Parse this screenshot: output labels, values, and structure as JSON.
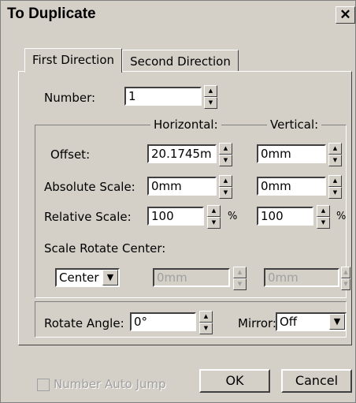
{
  "window": {
    "title": "To Duplicate",
    "close_glyph": "✕"
  },
  "tabs": [
    {
      "label": "First Direction",
      "active": true
    },
    {
      "label": "Second Direction",
      "active": false
    }
  ],
  "number": {
    "label": "Number:",
    "value": "1"
  },
  "columns": {
    "horizontal": "Horizontal:",
    "vertical": "Vertical:"
  },
  "offset": {
    "label": "Offset:",
    "horizontal": "20.1745m",
    "vertical": "0mm"
  },
  "absolute_scale": {
    "label": "Absolute Scale:",
    "horizontal": "0mm",
    "vertical": "0mm"
  },
  "relative_scale": {
    "label": "Relative Scale:",
    "horizontal": "100",
    "horizontal_unit": "%",
    "vertical": "100",
    "vertical_unit": "%"
  },
  "scale_rotate_center": {
    "label": "Scale Rotate Center:",
    "selected": "Center",
    "horizontal": "0mm",
    "vertical": "0mm"
  },
  "rotate_angle": {
    "label": "Rotate Angle:",
    "value": "0°"
  },
  "mirror": {
    "label": "Mirror:",
    "selected": "Off"
  },
  "footer": {
    "number_auto_jump": "Number Auto Jump",
    "ok": "OK",
    "cancel": "Cancel"
  },
  "icons": {
    "spin_up": "▲",
    "spin_down": "▼",
    "dropdown": "▼"
  }
}
